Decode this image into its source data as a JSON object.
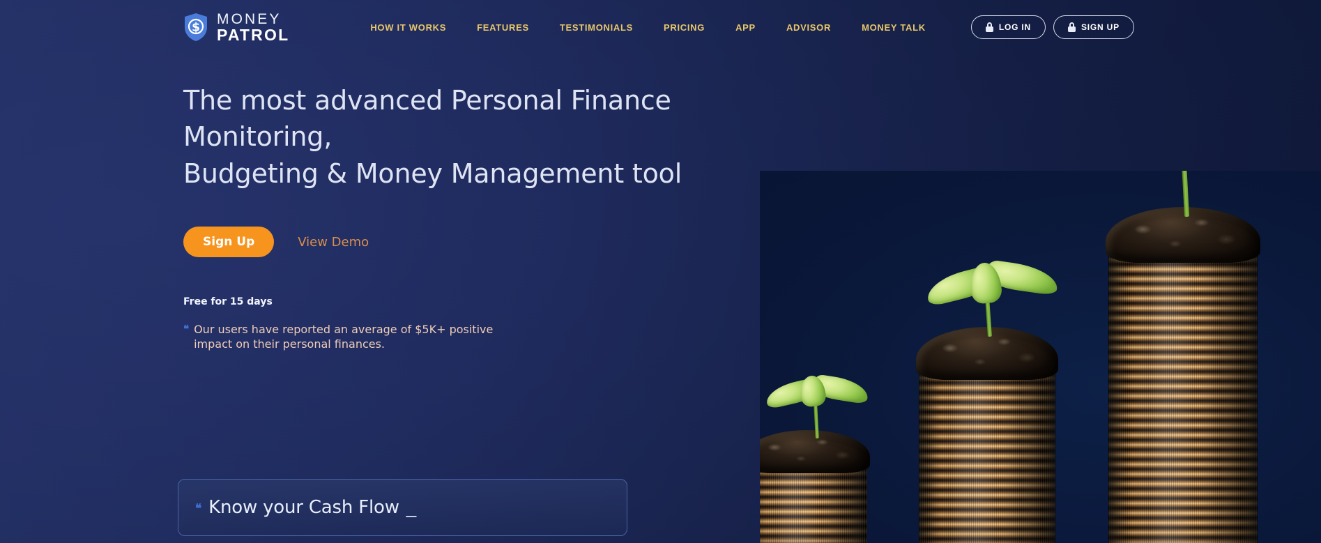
{
  "brand": {
    "logo_icon": "shield-dollar-icon",
    "name_top": "MONEY",
    "name_bottom": "PATROL"
  },
  "colors": {
    "bg_left": "#25316a",
    "bg_right": "#141f45",
    "nav_link": "#e8c76a",
    "accent_orange": "#f7941d",
    "demo_link": "#d98f4e",
    "quote_text": "#f0cdb7",
    "quote_mark": "#3f6fd0",
    "headline": "#dfe4f4",
    "tagline_border": "#4a63a6"
  },
  "nav": {
    "items": [
      {
        "label": "HOW IT WORKS",
        "name": "nav-link-how-it-works"
      },
      {
        "label": "FEATURES",
        "name": "nav-link-features"
      },
      {
        "label": "TESTIMONIALS",
        "name": "nav-link-testimonials"
      },
      {
        "label": "PRICING",
        "name": "nav-link-pricing"
      },
      {
        "label": "APP",
        "name": "nav-link-app"
      },
      {
        "label": "ADVISOR",
        "name": "nav-link-advisor"
      },
      {
        "label": "MONEY TALK",
        "name": "nav-link-money-talk"
      }
    ],
    "login_label": "LOG IN",
    "signup_label": "SIGN UP",
    "login_icon": "lock-icon",
    "signup_icon": "lock-icon"
  },
  "hero": {
    "headline_line1": "The most advanced Personal Finance Monitoring,",
    "headline_line2": "Budgeting & Money Management tool",
    "signup_cta": "Sign Up",
    "demo_cta": "View Demo",
    "free_note": "Free for 15 days",
    "quote_mark": "❝",
    "quote_text": "Our users have reported an average of $5K+ positive impact on their personal finances."
  },
  "tagline": {
    "quote_mark": "❝",
    "text": "Know your Cash Flow",
    "caret": "_"
  },
  "photo": {
    "alt": "three-ascending-coin-stacks-with-sprouts"
  }
}
